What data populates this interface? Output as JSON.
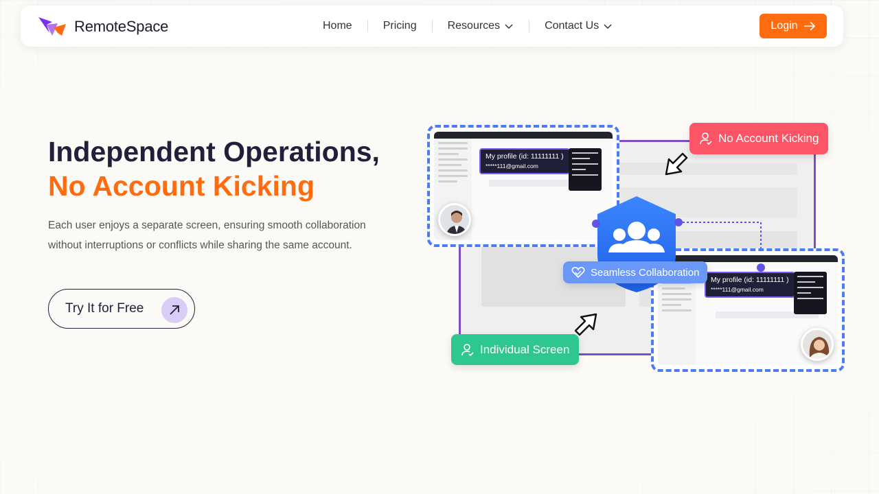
{
  "brand": {
    "name": "RemoteSpace",
    "accent": "#ff6b0f",
    "logo_purple": "#7b2ff2"
  },
  "nav": {
    "items": [
      {
        "label": "Home",
        "has_dropdown": false
      },
      {
        "label": "Pricing",
        "has_dropdown": false
      },
      {
        "label": "Resources",
        "has_dropdown": true
      },
      {
        "label": "Contact Us",
        "has_dropdown": true
      }
    ],
    "login_label": "Login"
  },
  "hero": {
    "title_line1": "Independent Operations,",
    "title_line2": "No Account Kicking",
    "description": "Each user enjoys a separate screen, ensuring smooth collaboration without interruptions or conflicts while sharing the same account.",
    "cta_label": "Try It for Free"
  },
  "illustration": {
    "badge_no_kicking": "No Account Kicking",
    "badge_individual": "Individual Screen",
    "badge_collab": "Seamless Collaboration",
    "profile_left": {
      "title": "My profile (id: 11111111 )",
      "email": "*****111@gmail.com"
    },
    "profile_right": {
      "title": "My profile (id: 11111111 )",
      "email": "*****111@gmail.com"
    },
    "colors": {
      "red": "#fd5566",
      "green": "#2dc78f",
      "blue": "#6a98f8",
      "dashed": "#4b7bf5",
      "frame": "#7a4fc4"
    }
  }
}
